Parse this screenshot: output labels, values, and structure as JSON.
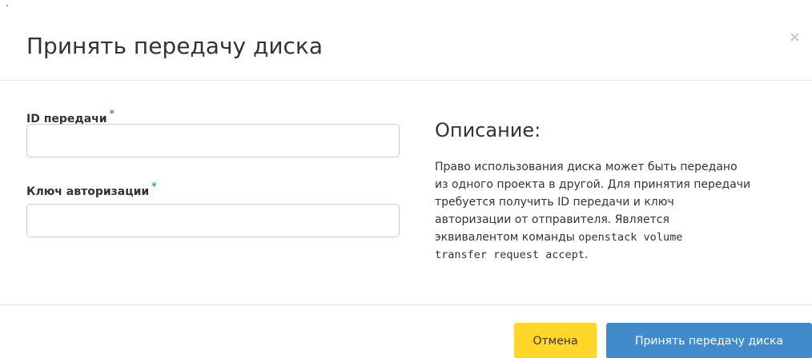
{
  "dialog": {
    "title": "Принять передачу диска",
    "close_icon": "×"
  },
  "form": {
    "transfer_id": {
      "label": "ID передачи",
      "required_mark": "*",
      "value": "",
      "placeholder": ""
    },
    "auth_key": {
      "label": "Ключ авторизации",
      "required_mark": "*",
      "value": "",
      "placeholder": ""
    }
  },
  "description": {
    "title": "Описание:",
    "text_lines": [
      "Право использования диска может быть передано",
      "из одного проекта в другой. Для принятия передачи",
      "требуется получить ID передачи и ключ",
      "авторизации от отправителя. Является",
      "эквивалентом команды"
    ],
    "command_part1": "openstack volume",
    "command_part2": "transfer request accept",
    "end_punct": "."
  },
  "footer": {
    "cancel_label": "Отмена",
    "submit_label": "Принять передачу диска"
  },
  "colors": {
    "accent_blue": "#428bca",
    "cancel_yellow": "#ffd72b",
    "required_star": "#3f88c8"
  }
}
